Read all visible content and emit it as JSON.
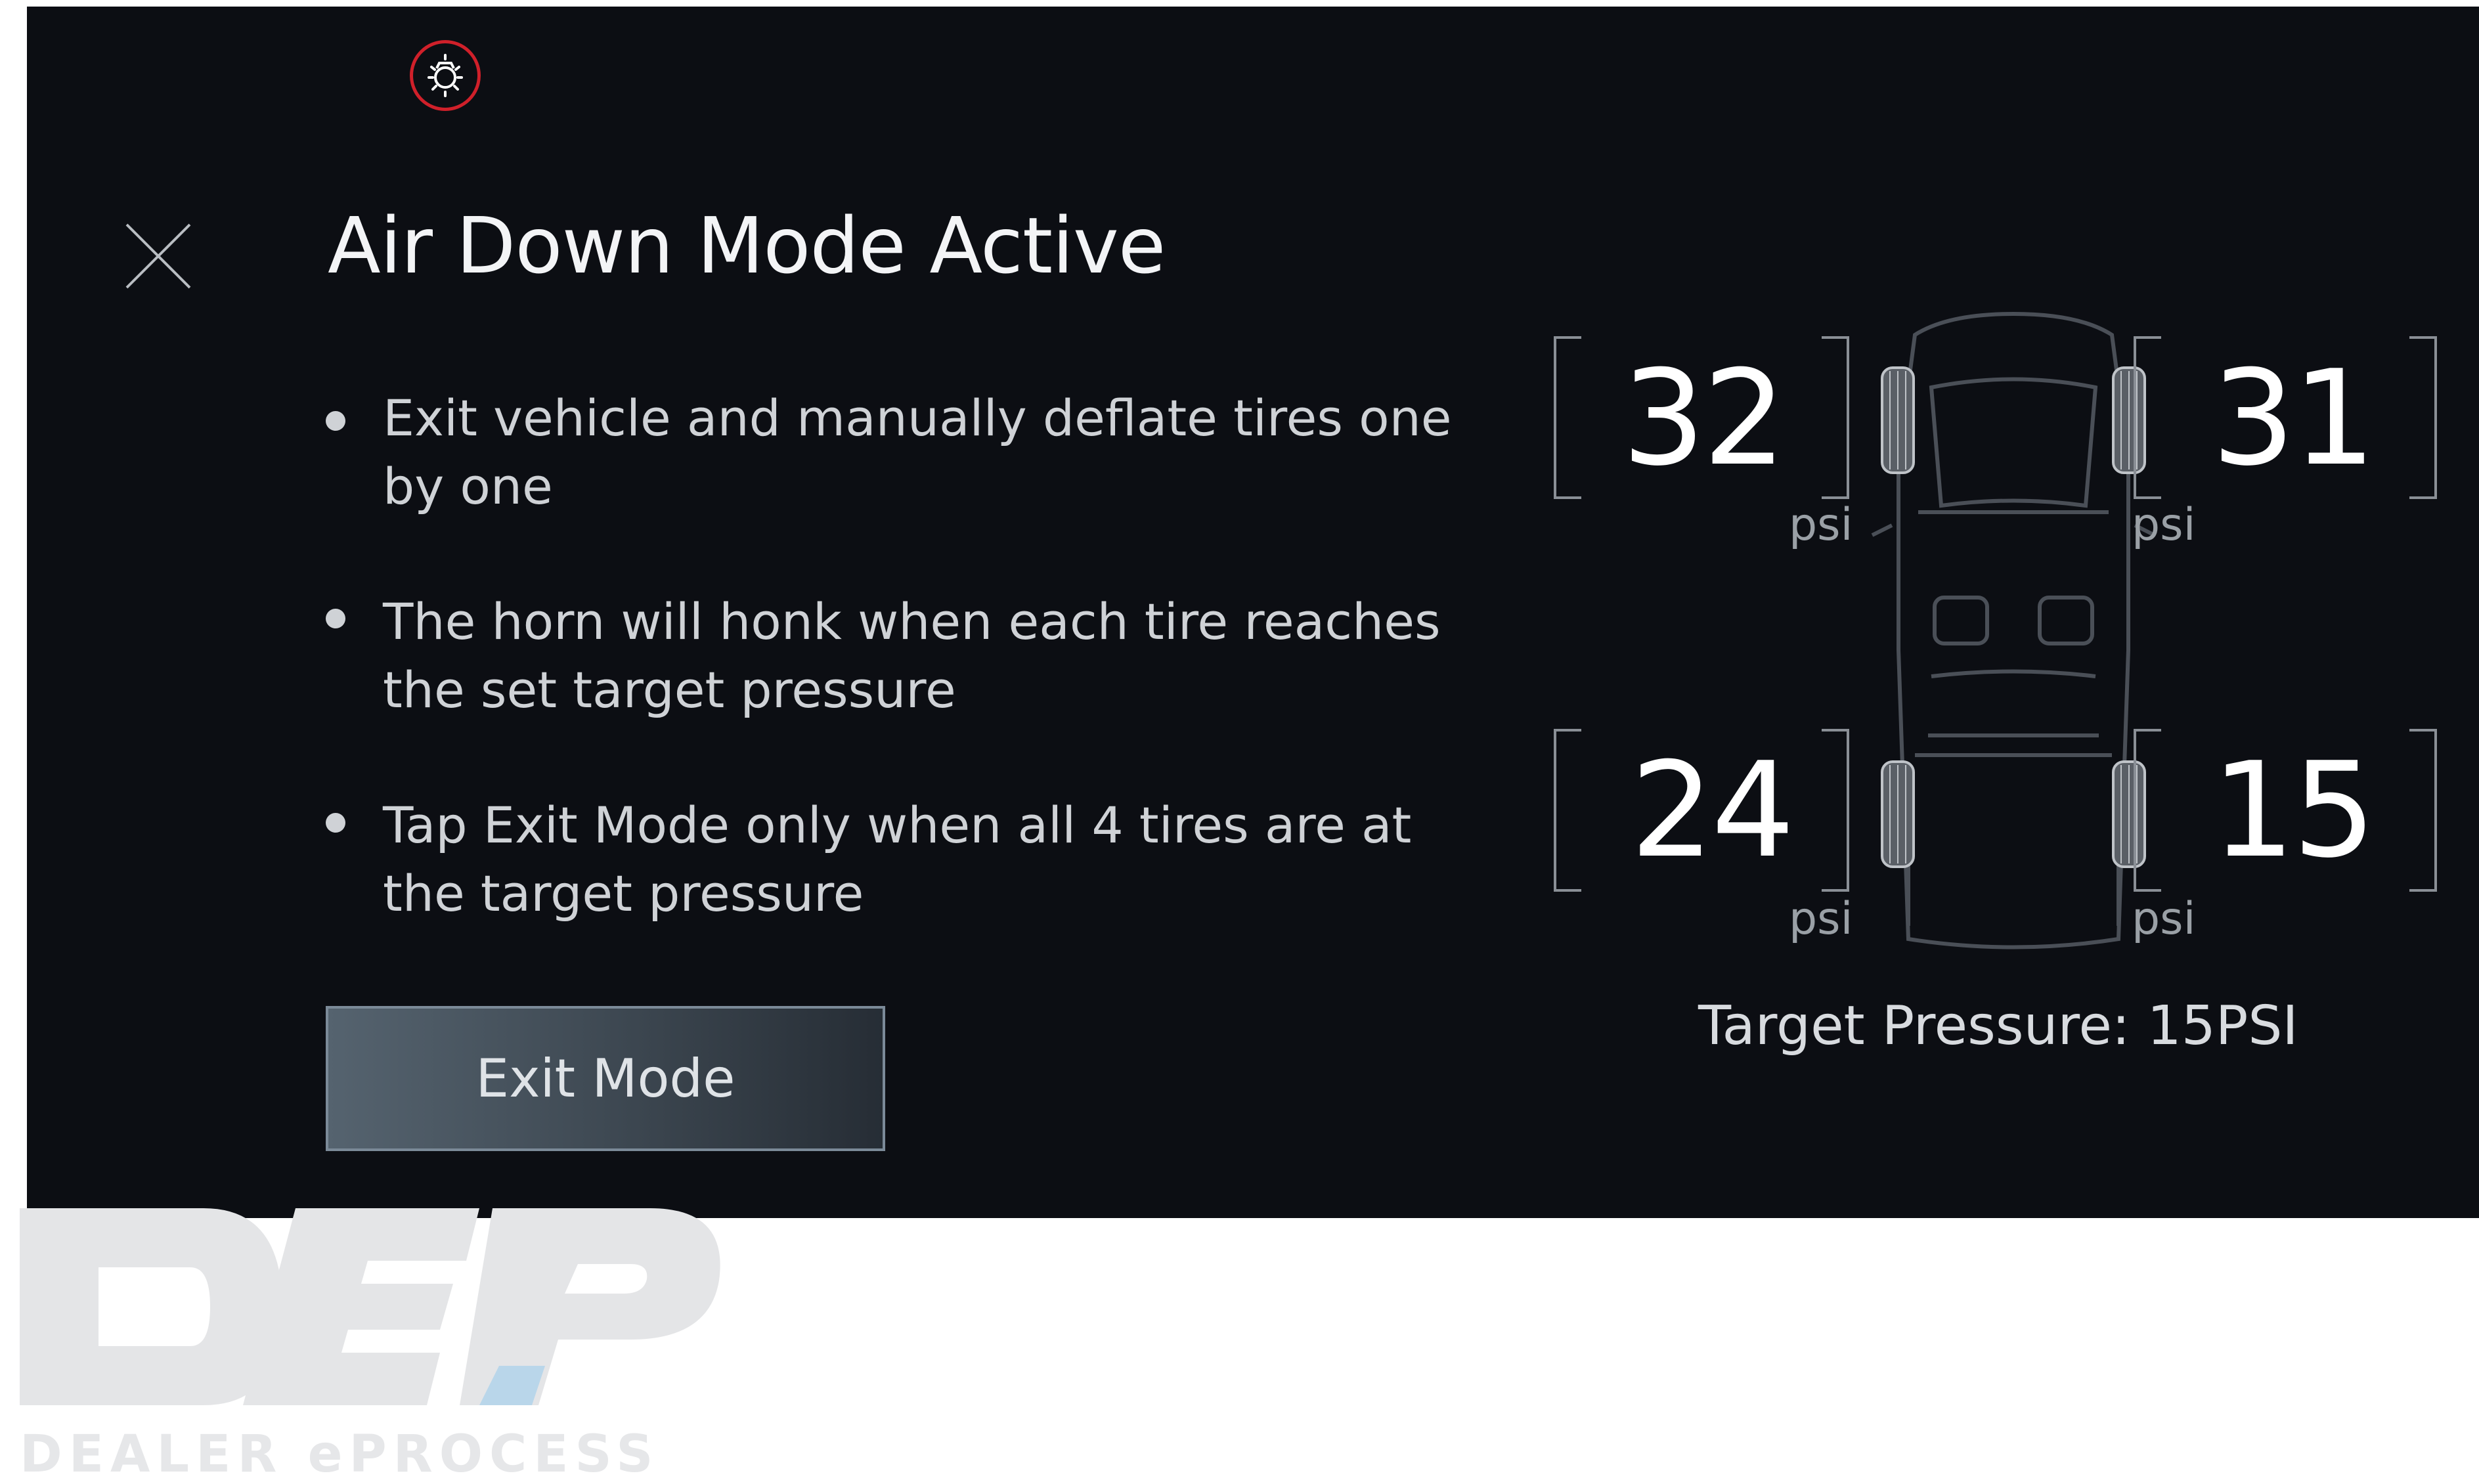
{
  "title": "Air Down Mode Active",
  "bullets": [
    "Exit vehicle and manually deflate tires one by one",
    "The horn will honk when each tire reaches the set target pressure",
    "Tap Exit Mode only when all 4 tires are at the target pressure"
  ],
  "exit_button_label": "Exit Mode",
  "tires": {
    "front_left": {
      "value": "32",
      "unit": "psi"
    },
    "front_right": {
      "value": "31",
      "unit": "psi"
    },
    "rear_left": {
      "value": "24",
      "unit": "psi"
    },
    "rear_right": {
      "value": "15",
      "unit": "psi"
    }
  },
  "target_pressure": "Target Pressure: 15PSI",
  "icons": {
    "warning": "tire-pressure-warning-icon",
    "close": "close-icon"
  },
  "colors": {
    "background": "#0c0e13",
    "warning": "#d0202a",
    "text": "#cfd2d6"
  },
  "watermark": {
    "logo": "DEP",
    "text": "DEALER ePROCESS"
  }
}
